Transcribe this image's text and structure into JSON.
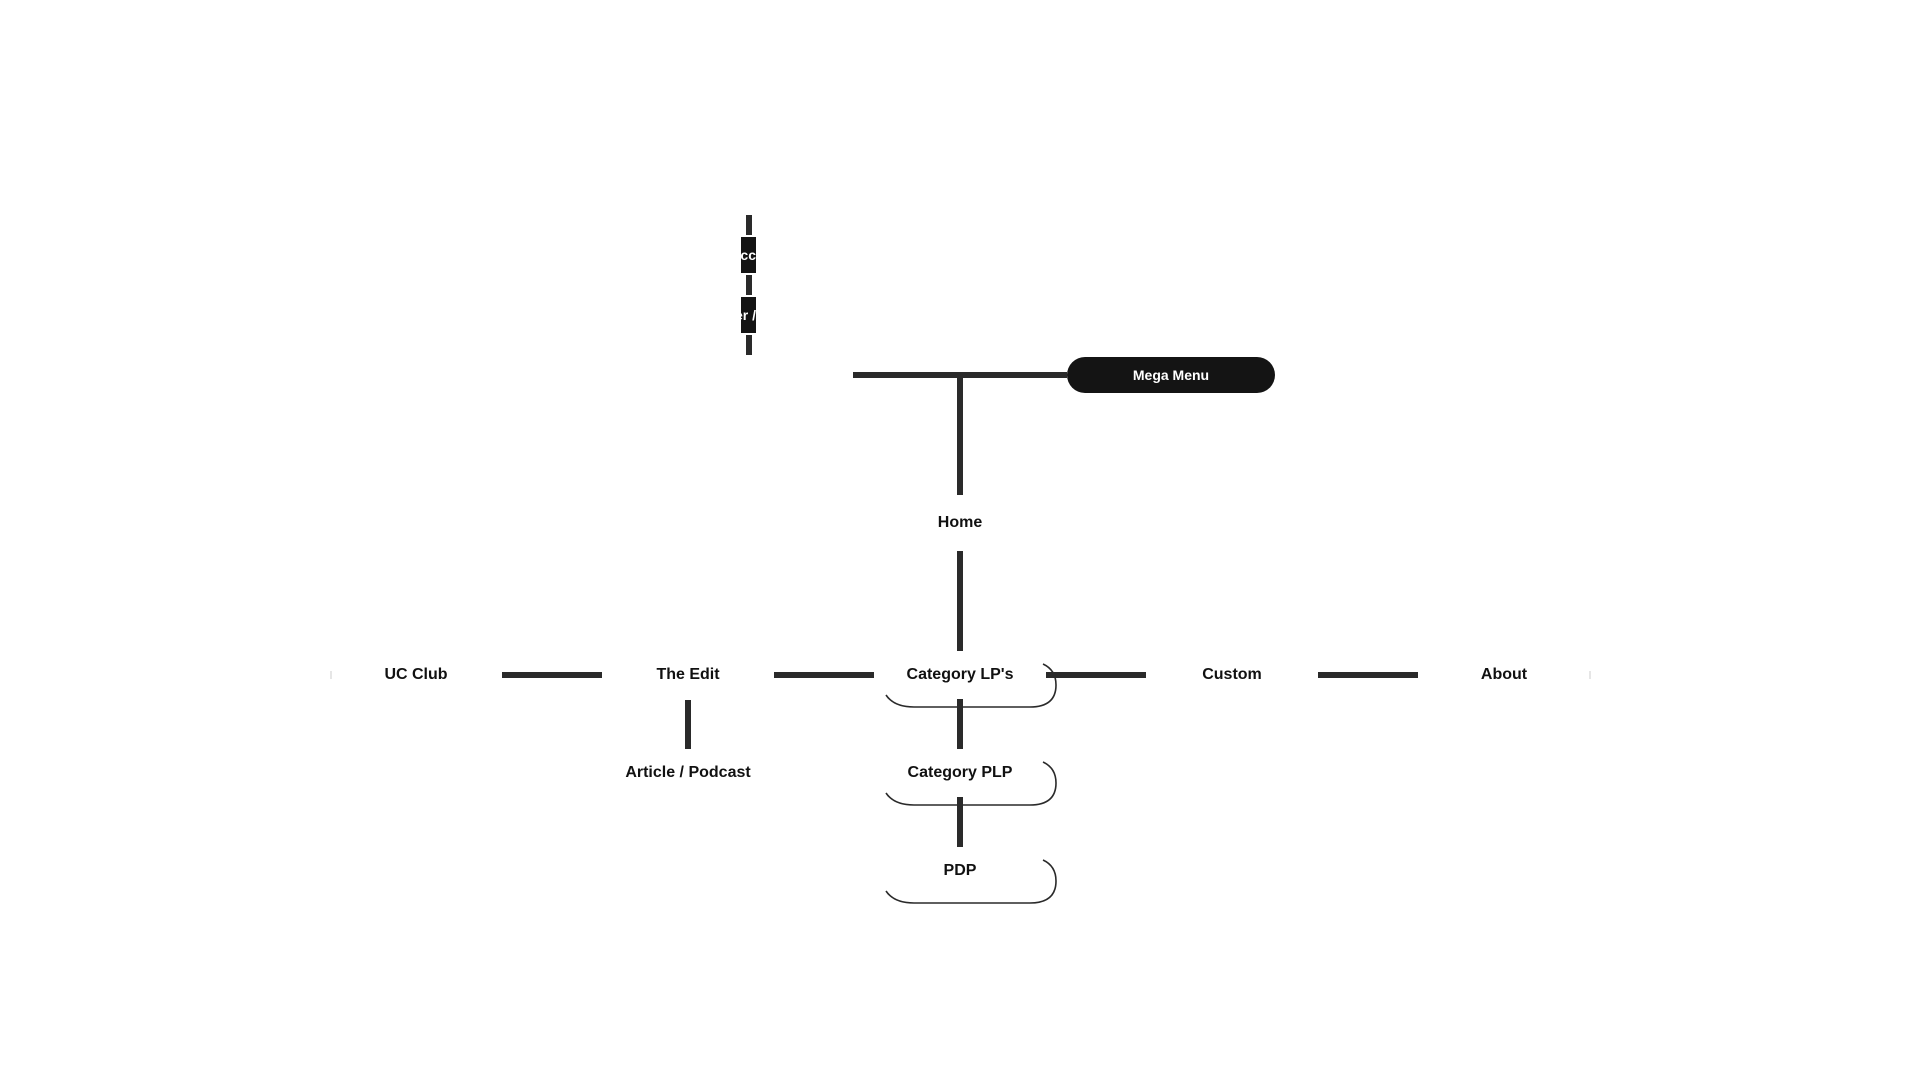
{
  "diagram": {
    "top_stack": {
      "items": [
        {
          "visible_text": "cc"
        },
        {
          "visible_text": "er /"
        }
      ]
    },
    "mega_menu": {
      "label": "Mega Menu"
    },
    "root": {
      "label": "Home"
    },
    "level1": [
      {
        "label": "UC Club"
      },
      {
        "label": "The Edit"
      },
      {
        "label": "Category LP's"
      },
      {
        "label": "Custom"
      },
      {
        "label": "About"
      }
    ],
    "the_edit_children": [
      {
        "label": "Article / Podcast"
      }
    ],
    "category_chain": [
      {
        "label": "Category PLP"
      },
      {
        "label": "PDP"
      }
    ],
    "colors": {
      "connector": "#2a2a2a",
      "pill_fill": "#141414",
      "pill_text": "#ffffff",
      "label_text": "#111111"
    }
  }
}
